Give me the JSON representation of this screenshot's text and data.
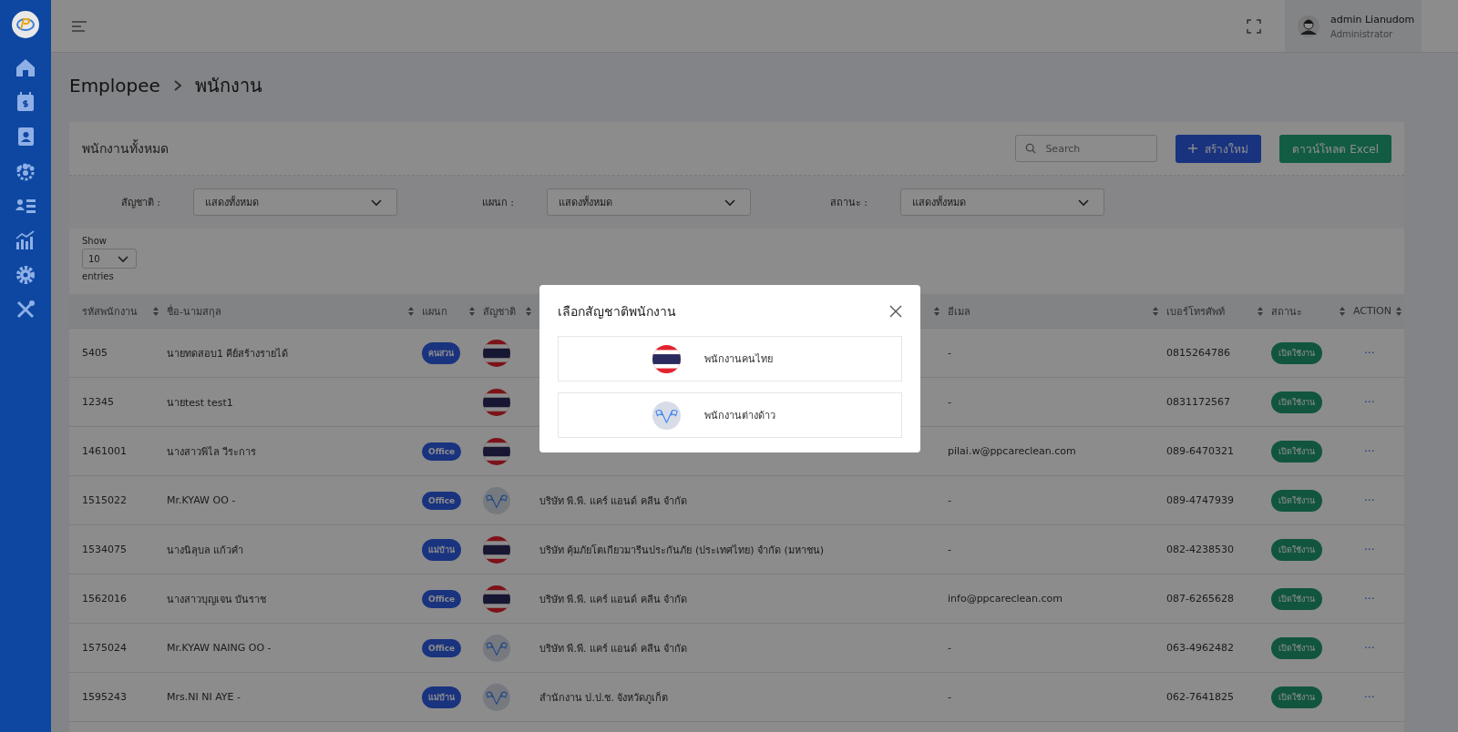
{
  "topbar": {
    "user_name": "admin Lianudom",
    "user_role": "Administrator"
  },
  "breadcrumb": [
    "Emplopee",
    "พนักงาน"
  ],
  "card": {
    "title": "พนักงานทั้งหมด",
    "search": {
      "placeholder": "Search"
    },
    "create_button": "สร้างใหม่",
    "excel_button": "ดาวน์โหลด Excel"
  },
  "filters": [
    {
      "label": "สัญชาติ :",
      "value": "แสดงทั้งหมด"
    },
    {
      "label": "แผนก :",
      "value": "แสดงทั้งหมด"
    },
    {
      "label": "สถานะ :",
      "value": "แสดงทั้งหมด"
    }
  ],
  "page_length": {
    "before": "Show",
    "value": "10",
    "after": "entries"
  },
  "table": {
    "columns": [
      {
        "label": "รหัสพนักงาน",
        "sortable": true
      },
      {
        "label": "ชื่อ-นามสกุล",
        "sortable": true
      },
      {
        "label": "แผนก",
        "sortable": true
      },
      {
        "label": "สัญชาติ",
        "sortable": true
      },
      {
        "sortable": true
      },
      {
        "label": "อีเมล",
        "sortable": true
      },
      {
        "label": "เบอร์โทรศัพท์",
        "sortable": true
      },
      {
        "label": "สถานะ",
        "sortable": true
      },
      {
        "label": "ACTION",
        "sortable": true
      }
    ],
    "rows": [
      {
        "code": "5405",
        "name": "นายทดสอบ1 คีย์สร้างรายได้",
        "department": "คนสวน",
        "nationality": {
          "kind": "thai"
        },
        "email": "-",
        "phone": "0815264786",
        "status": "เปิดใช้งาน",
        "action": "···"
      },
      {
        "code": "12345",
        "name": "นายtest test1",
        "nationality": {
          "kind": "thai"
        },
        "email": "-",
        "phone": "0831172567",
        "status": "เปิดใช้งาน",
        "action": "···"
      },
      {
        "code": "1461001",
        "name": "นางสาวพิไล วีระการ",
        "department": "Office",
        "nationality": {
          "kind": "thai"
        },
        "email": "pilai.w@ppcareclean.com",
        "phone": "089-6470321",
        "status": "เปิดใช้งาน",
        "action": "···"
      },
      {
        "code": "1515022",
        "name": "Mr.KYAW OO -",
        "department": "Office",
        "nationality": {
          "kind": "foreign"
        },
        "company": "บริษัท พี.พี. แคร์ แอนด์ คลีน จำกัด",
        "email": "-",
        "phone": "089-4747939",
        "status": "เปิดใช้งาน",
        "action": "···"
      },
      {
        "code": "1534075",
        "name": "นางนิลุบล แก้วคำ",
        "department": "แม่บ้าน",
        "nationality": {
          "kind": "thai"
        },
        "company": "บริษัท คุ้มภัยโตเกียวมารีนประกันภัย (ประเทศไทย) จำกัด (มหาชน)",
        "email": "-",
        "phone": "082-4238530",
        "status": "เปิดใช้งาน",
        "action": "···"
      },
      {
        "code": "1562016",
        "name": "นางสาวบุญเจน บันราช",
        "department": "Office",
        "nationality": {
          "kind": "thai"
        },
        "company": "บริษัท พี.พี. แคร์ แอนด์ คลีน จำกัด",
        "email": "info@ppcareclean.com",
        "phone": "087-6265628",
        "status": "เปิดใช้งาน",
        "action": "···"
      },
      {
        "code": "1575024",
        "name": "Mr.KYAW NAING OO -",
        "department": "Office",
        "nationality": {
          "kind": "foreign"
        },
        "company": "บริษัท พี.พี. แคร์ แอนด์ คลีน จำกัด",
        "email": "-",
        "phone": "063-4962482",
        "status": "เปิดใช้งาน",
        "action": "···"
      },
      {
        "code": "1595243",
        "name": "Mrs.NI NI AYE -",
        "department": "แม่บ้าน",
        "nationality": {
          "kind": "foreign"
        },
        "company": "สำนักงาน ป.ป.ช. จังหวัดภูเก็ต",
        "email": "-",
        "phone": "062-7641825",
        "status": "เปิดใช้งาน",
        "action": "···"
      }
    ]
  },
  "dialog": {
    "title": "เลือกสัญชาติพนักงาน",
    "options": [
      {
        "kind": "thai",
        "label": "พนักงานคนไทย"
      },
      {
        "kind": "foreign",
        "label": "พนักงานต่างด้าว"
      }
    ]
  }
}
